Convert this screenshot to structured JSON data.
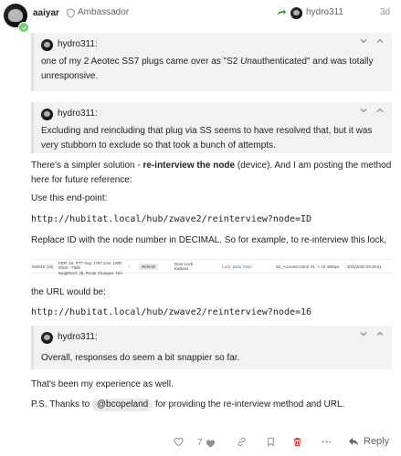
{
  "header": {
    "username": "aaiyar",
    "role": "Ambassador",
    "reply_to_user": "hydro311",
    "date": "3d"
  },
  "quotes": [
    {
      "author": "hydro311:",
      "body_pre": "one of my 2 Aeotec SS7 plugs came over as \"S2 ",
      "body_em": "Un",
      "body_post": "authenticated\" and was totally unresponsive."
    },
    {
      "author": "hydro311:",
      "body": "Excluding and reincluding that plug via SS seems to have resolved that, but it was very stubborn to exclude so that took a bunch of attempts."
    },
    {
      "author": "hydro311:",
      "body": "Overall, responses do seem a bit snappier so far."
    }
  ],
  "content": {
    "p1_pre": "There's a simpler solution - ",
    "p1_bold": "re-interview the node",
    "p1_post": " (device). And I am posting the method here for future reference:",
    "p2": "Use this end-point:",
    "code1": "http://hubitat.local/hub/zwave2/reinterview?node=ID",
    "p3": "Replace ID with the node number in DECIMAL. So for example, to re-interview this lock,",
    "p4": "the URL would be:",
    "code2": "http://hubitat.local/hub/zwave2/reinterview?node=16",
    "p5": "That's been my experience as well.",
    "p6_pre": "P.S. Thanks to ",
    "p6_mention": "@bcopeland",
    "p6_post": " for providing the re-interview method and URL."
  },
  "device_row": {
    "node_id": "0x0010 (16)",
    "stats_line1": "PER: 16, RTT Avg: 1787.1ms, LWR",
    "stats_line2": "RSSI: -79db",
    "stats_line3": "Neighbors: 26, Route Changes: N/A",
    "refresh_label": "Refresh",
    "device_type": "Door Lock",
    "device_brand": "Kwikset",
    "device_link": "Lock: Back Patio",
    "security": "S2_AccessControl",
    "route": "01 -> 10 40kbps",
    "timestamp": "3/31/2025 09:26:51"
  },
  "footer": {
    "like_count": "7",
    "reply_label": "Reply"
  },
  "colors": {
    "text": "#222222",
    "muted": "#919191",
    "quote_bg": "#f2f2f2",
    "reply_arrow": "#3d9b37",
    "delete_icon": "#c62828"
  }
}
